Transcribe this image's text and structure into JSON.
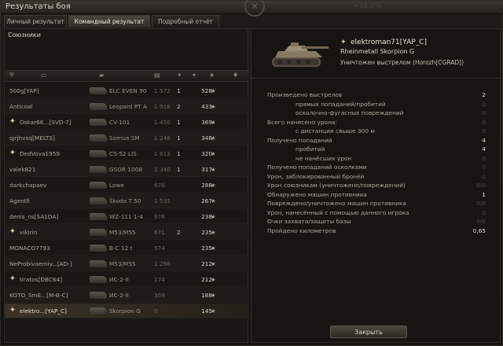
{
  "window": {
    "title": "Результаты боя",
    "ghost": "+38.0%"
  },
  "tabs": [
    {
      "label": "Личный результат"
    },
    {
      "label": "Командный результат"
    },
    {
      "label": "Подробный отчёт"
    }
  ],
  "team": {
    "heading": "Союзники",
    "rows": [
      {
        "player": "500g[YAP]",
        "tank": "ELC EVEN 90",
        "damage": "1 572",
        "frags": "1",
        "xp": "528",
        "medal": false
      },
      {
        "player": "Anticoal",
        "tank": "Leopard PT A",
        "damage": "1 918",
        "frags": "2",
        "xp": "433",
        "medal": false
      },
      {
        "player": "Oskar66...[SVD-7]",
        "tank": "CV-101",
        "damage": "1 450",
        "frags": "1",
        "xp": "369",
        "medal": true
      },
      {
        "player": "qjrjhvsq[MELTS]",
        "tank": "Somua SM",
        "damage": "1 248",
        "frags": "1",
        "xp": "346",
        "medal": false
      },
      {
        "player": "DedVova1959",
        "tank": "CS-52 LIS",
        "damage": "1 613",
        "frags": "1",
        "xp": "320",
        "medal": true
      },
      {
        "player": "valek821",
        "tank": "GSOR 1008",
        "damage": "1 340",
        "frags": "1",
        "xp": "317",
        "medal": false
      },
      {
        "player": "darkchapaev",
        "tank": "Lowe",
        "damage": "676",
        "frags": "",
        "xp": "288",
        "medal": false
      },
      {
        "player": "Agentll",
        "tank": "Škoda T 50",
        "damage": "1 535",
        "frags": "",
        "xp": "267",
        "medal": false
      },
      {
        "player": "denis_ns[SA1DA]",
        "tank": "WZ-111 1-4",
        "damage": "976",
        "frags": "",
        "xp": "238",
        "medal": false
      },
      {
        "player": "vikirin",
        "tank": "M53/M55",
        "damage": "671",
        "frags": "2",
        "xp": "235",
        "medal": true
      },
      {
        "player": "MONACO7793",
        "tank": "В-С 12 t",
        "damage": "574",
        "frags": "",
        "xp": "235",
        "medal": false
      },
      {
        "player": "NeProbivaemiy...[AD-]",
        "tank": "M53/M55",
        "damage": "1 286",
        "frags": "",
        "xp": "212",
        "medal": false
      },
      {
        "player": "tiratos[DBC64]",
        "tank": "ИС-2-II",
        "damage": "174",
        "frags": "",
        "xp": "212",
        "medal": true
      },
      {
        "player": "KOTO_SmE...[M-B-C]",
        "tank": "ИС-2-II",
        "damage": "369",
        "frags": "",
        "xp": "188",
        "medal": false
      },
      {
        "player": "elektro...[YAP_C]",
        "tank": "Skorpion G",
        "damage": "0",
        "frags": "",
        "xp": "145",
        "medal": true,
        "me": true
      }
    ]
  },
  "detail": {
    "player": "elektroman71[YAP_C]",
    "tank": "Rheinmetall Skorpion G",
    "killed_by": "Уничтожен выстрелом (Horozh[CGRAD])",
    "stats": [
      {
        "label": "Произведено выстрелов",
        "value": "2",
        "sub": false
      },
      {
        "label": "прямых попаданий/пробитий",
        "value": "0",
        "sub": true
      },
      {
        "label": "осколочно-фугасных повреждений",
        "value": "0",
        "sub": true
      },
      {
        "label": "Всего нанесено урона:",
        "value": "0",
        "sub": false
      },
      {
        "label": "с дистанции свыше 300 м",
        "value": "0",
        "sub": true
      },
      {
        "label": "Получено попаданий",
        "value": "4",
        "sub": false
      },
      {
        "label": "пробитий",
        "value": "4",
        "sub": true
      },
      {
        "label": "не нанёсших урон",
        "value": "0",
        "sub": true
      },
      {
        "label": "Получено попаданий осколками",
        "value": "0",
        "sub": false
      },
      {
        "label": "Урон, заблокированный бронёй",
        "value": "0",
        "sub": false
      },
      {
        "label": "Урон союзникам (уничтожено/повреждений)",
        "value": "0/0",
        "sub": false
      },
      {
        "label": "Обнаружено машин противника",
        "value": "1",
        "sub": false
      },
      {
        "label": "Повреждено/уничтожено машин противника",
        "value": "0/0",
        "sub": false
      },
      {
        "label": "Урон, нанесённый с помощью данного игрока",
        "value": "0",
        "sub": false
      },
      {
        "label": "Очки захвата/защиты базы",
        "value": "0/0",
        "sub": false
      },
      {
        "label": "Пройдено километров",
        "value": "0,65",
        "sub": false
      }
    ],
    "close_label": "Закрыть"
  }
}
